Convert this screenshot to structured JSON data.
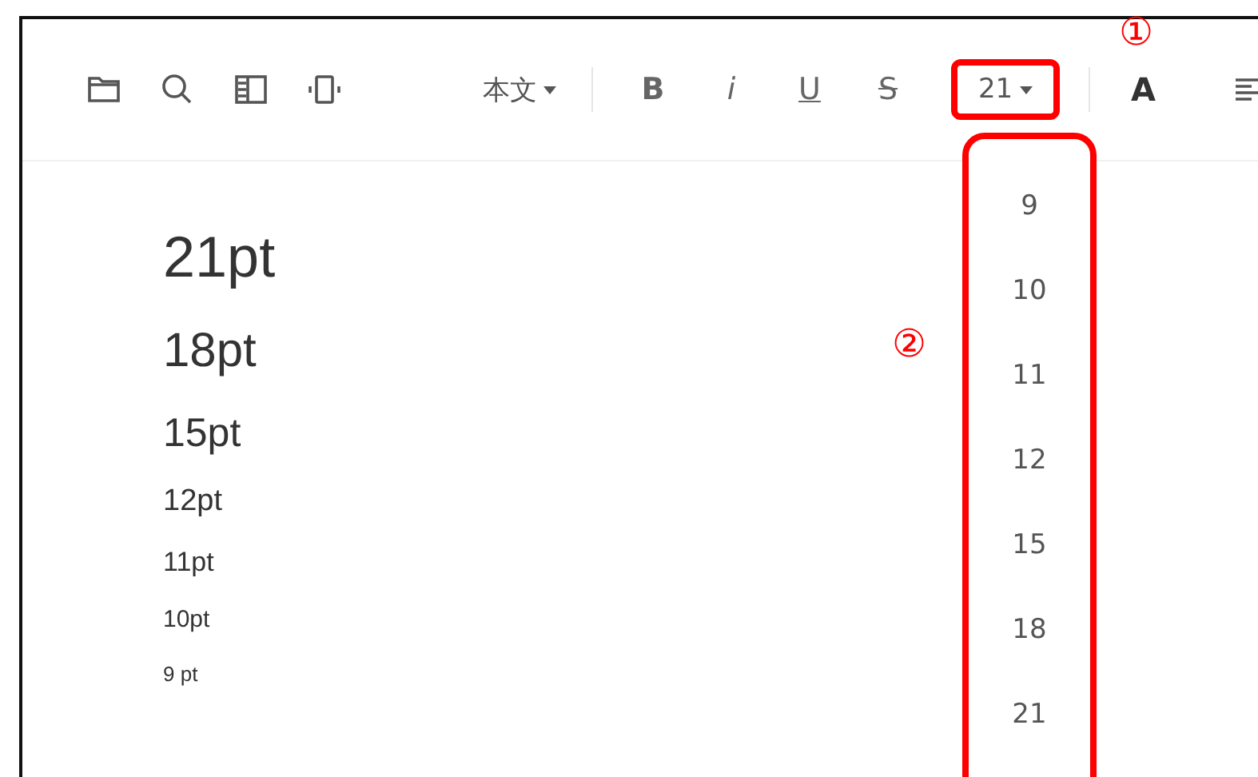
{
  "toolbar": {
    "left_tools": [
      {
        "kind": "folder"
      },
      {
        "kind": "search"
      },
      {
        "kind": "panel"
      },
      {
        "kind": "device"
      }
    ],
    "style_dropdown": {
      "label": "本文"
    },
    "format_buttons": [
      {
        "kind": "bold",
        "label": "B"
      },
      {
        "kind": "italic",
        "label": "i"
      },
      {
        "kind": "underline",
        "label": "U"
      },
      {
        "kind": "strike",
        "label": "S"
      }
    ],
    "font_size_dropdown": {
      "value": "21",
      "highlighted": true,
      "expanded": true
    },
    "color_button": {
      "label": "A"
    }
  },
  "font_size_menu": {
    "highlighted": true,
    "options": [
      {
        "label": "9",
        "selected": false
      },
      {
        "label": "10",
        "selected": false
      },
      {
        "label": "11",
        "selected": false
      },
      {
        "label": "12",
        "selected": false
      },
      {
        "label": "15",
        "selected": false
      },
      {
        "label": "18",
        "selected": false
      },
      {
        "label": "21",
        "selected": false
      }
    ]
  },
  "callouts": [
    {
      "label": "①"
    },
    {
      "label": "②"
    }
  ],
  "document": {
    "lines": [
      {
        "text": "21pt"
      },
      {
        "text": "18pt"
      },
      {
        "text": "15pt"
      },
      {
        "text": "12pt"
      },
      {
        "text": "11pt"
      },
      {
        "text": "10pt"
      },
      {
        "text": "9 pt"
      }
    ]
  }
}
